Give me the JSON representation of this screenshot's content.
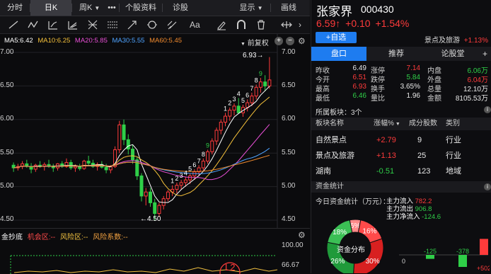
{
  "tabs": {
    "fenshi": "分时",
    "rik": "日K",
    "zhouk": "周K",
    "more": "•••",
    "ggzl": "个股资料",
    "zhengu": "诊股",
    "display": "显示",
    "drawline": "画线"
  },
  "ma": {
    "ma5": "MA5:6.42",
    "ma10": "MA10:6.25",
    "ma20": "MA20:5.85",
    "ma30": "MA30:5.55",
    "ma60": "MA60:5.45",
    "adjust": "前复权"
  },
  "colors": {
    "ma5": "#ffffff",
    "ma10": "#f5c13b",
    "ma20": "#e84fd6",
    "ma30": "#4fa3ff",
    "ma60": "#2ecc71",
    "up": "#ff3b3b",
    "down": "#2fcf48",
    "accent": "#1e7cf0"
  },
  "yaxis_left": [
    "7.00",
    "6.50",
    "6.00",
    "5.50",
    "5.00",
    "4.50"
  ],
  "yaxis_right": [
    "7.00",
    "6.50",
    "6.00",
    "5.50",
    "5.00",
    "4.50"
  ],
  "annotations": {
    "high": "6.93→",
    "low": "←4.50"
  },
  "chart_data": {
    "type": "candlestick",
    "ylim": [
      4.5,
      7.0
    ],
    "candles": [
      [
        5.32,
        5.36,
        5.22,
        5.28
      ],
      [
        5.28,
        5.34,
        5.24,
        5.3
      ],
      [
        5.3,
        5.38,
        5.26,
        5.34
      ],
      [
        5.34,
        5.4,
        5.28,
        5.3
      ],
      [
        5.3,
        5.35,
        5.2,
        5.26
      ],
      [
        5.26,
        5.34,
        5.22,
        5.32
      ],
      [
        5.32,
        5.38,
        5.28,
        5.3
      ],
      [
        5.3,
        5.36,
        5.24,
        5.33
      ],
      [
        5.33,
        5.4,
        5.28,
        5.3
      ],
      [
        5.3,
        5.34,
        5.22,
        5.28
      ],
      [
        5.28,
        5.35,
        5.24,
        5.34
      ],
      [
        5.34,
        5.38,
        5.28,
        5.3
      ],
      [
        5.3,
        5.42,
        5.28,
        5.36
      ],
      [
        5.36,
        5.4,
        5.25,
        5.28
      ],
      [
        5.28,
        5.33,
        5.22,
        5.3
      ],
      [
        5.3,
        5.34,
        5.24,
        5.27
      ],
      [
        5.27,
        5.4,
        5.25,
        5.38
      ],
      [
        5.38,
        5.46,
        5.32,
        5.35
      ],
      [
        5.35,
        5.4,
        5.28,
        5.3
      ],
      [
        5.3,
        5.36,
        5.24,
        5.33
      ],
      [
        5.33,
        5.38,
        5.27,
        5.29
      ],
      [
        5.29,
        5.34,
        5.2,
        5.25
      ],
      [
        5.25,
        5.32,
        5.2,
        5.3
      ],
      [
        5.3,
        5.6,
        5.28,
        5.55
      ],
      [
        5.55,
        5.98,
        5.5,
        5.92
      ],
      [
        5.92,
        6.0,
        5.62,
        5.7
      ],
      [
        5.7,
        5.78,
        5.48,
        5.56
      ],
      [
        5.56,
        5.62,
        5.34,
        5.4
      ],
      [
        5.4,
        5.44,
        5.1,
        5.16
      ],
      [
        5.16,
        5.2,
        4.78,
        4.86
      ],
      [
        4.86,
        4.98,
        4.72,
        4.92
      ],
      [
        4.92,
        4.98,
        4.7,
        4.76
      ],
      [
        4.76,
        4.82,
        4.5,
        4.6
      ],
      [
        4.6,
        4.76,
        4.55,
        4.72
      ],
      [
        4.72,
        4.86,
        4.66,
        4.82
      ],
      [
        4.82,
        4.95,
        4.78,
        4.92
      ],
      [
        4.92,
        5.02,
        4.86,
        4.96
      ],
      [
        4.96,
        5.06,
        4.9,
        5.02
      ],
      [
        5.02,
        5.1,
        4.96,
        5.06
      ],
      [
        5.06,
        5.14,
        5.0,
        5.1
      ],
      [
        5.1,
        5.2,
        5.04,
        5.16
      ],
      [
        5.16,
        5.26,
        5.1,
        5.22
      ],
      [
        5.22,
        5.32,
        5.16,
        5.28
      ],
      [
        5.28,
        5.42,
        5.24,
        5.38
      ],
      [
        5.38,
        5.55,
        5.34,
        5.52
      ],
      [
        5.52,
        5.72,
        5.48,
        5.68
      ],
      [
        5.68,
        5.88,
        5.62,
        5.84
      ],
      [
        5.84,
        6.0,
        5.78,
        5.96
      ],
      [
        5.96,
        6.1,
        5.9,
        6.05
      ],
      [
        6.05,
        6.18,
        5.98,
        6.14
      ],
      [
        6.14,
        6.24,
        6.06,
        6.2
      ],
      [
        6.2,
        6.32,
        6.14,
        6.1
      ],
      [
        6.1,
        6.22,
        6.04,
        6.18
      ],
      [
        6.18,
        6.3,
        6.12,
        6.25
      ],
      [
        6.25,
        6.4,
        6.2,
        6.35
      ],
      [
        6.35,
        6.52,
        6.3,
        6.48
      ],
      [
        6.48,
        6.62,
        6.4,
        6.56
      ],
      [
        6.56,
        6.66,
        6.42,
        6.5
      ],
      [
        6.5,
        6.93,
        6.46,
        6.59
      ]
    ],
    "count_marks": [
      {
        "i": 36,
        "t": "1"
      },
      {
        "i": 37,
        "t": "2"
      },
      {
        "i": 38,
        "t": "3"
      },
      {
        "i": 39,
        "t": "4"
      },
      {
        "i": 40,
        "t": "5"
      },
      {
        "i": 41,
        "t": "6"
      },
      {
        "i": 42,
        "t": "7"
      },
      {
        "i": 43,
        "t": "8"
      },
      {
        "i": 44,
        "t": "9"
      },
      {
        "i": 48,
        "t": "1"
      },
      {
        "i": 49,
        "t": "2"
      },
      {
        "i": 50,
        "t": "3"
      },
      {
        "i": 51,
        "t": "4"
      },
      {
        "i": 52,
        "t": "5"
      },
      {
        "i": 53,
        "t": "6"
      },
      {
        "i": 54,
        "t": "7"
      },
      {
        "i": 55,
        "t": "8"
      },
      {
        "i": 56,
        "t": "9"
      }
    ]
  },
  "indicator": {
    "title": "金抄底",
    "opp": "机会区:--",
    "risk": "风险区:--",
    "coef": "风险系数:--",
    "max": "100.00",
    "mid": "66.67"
  },
  "quote": {
    "name": "张家界",
    "code": "000430",
    "price": "6.59↑",
    "change": "+0.10",
    "pct": "+1.54%",
    "add": "+自选",
    "sector": "景点及旅游",
    "sector_pct": "+1.13%",
    "subtabs": [
      "盘口",
      "推荐",
      "论股堂"
    ],
    "stats": [
      [
        "昨收",
        "6.49",
        "涨停",
        "7.14",
        "内盘",
        "6.06万"
      ],
      [
        "今开",
        "6.51",
        "跌停",
        "5.84",
        "外盘",
        "6.04万"
      ],
      [
        "最高",
        "6.93",
        "换手",
        "3.65%",
        "总量",
        "12.10万"
      ],
      [
        "最低",
        "6.46",
        "量比",
        "1.96",
        "金额",
        "8105.53万"
      ]
    ],
    "blocks_title": "所属板块：3个",
    "block_headers": [
      "板块名称",
      "涨幅%",
      "成分股数",
      "类别"
    ],
    "blocks": [
      {
        "name": "自然景点",
        "pct": "+2.79",
        "count": "9",
        "type": "行业",
        "color": "#ff3b3b"
      },
      {
        "name": "景点及旅游",
        "pct": "+1.13",
        "count": "25",
        "type": "行业",
        "color": "#ff3b3b"
      },
      {
        "name": "湖南",
        "pct": "-0.51",
        "count": "123",
        "type": "地域",
        "color": "#2fcf48"
      }
    ],
    "funds_title": "资金统计",
    "funds_sub": "今日资金统计（万元）：",
    "funds": [
      {
        "label": "主力流入",
        "value": "782.2",
        "color": "#ff3b3b"
      },
      {
        "label": "主力流出",
        "value": "906.8",
        "color": "#2fcf48"
      },
      {
        "label": "主力净流入",
        "value": "-124.6",
        "color": "#2fcf48"
      }
    ],
    "pie_center": "资金分布",
    "pie": [
      {
        "pct": "6%",
        "color": "#ff8a8a"
      },
      {
        "pct": "16%",
        "color": "#ff4a4a"
      },
      {
        "pct": "30%",
        "color": "#d82020"
      },
      {
        "pct": "26%",
        "color": "#1f9a3a"
      },
      {
        "pct": "18%",
        "color": "#3bbf55"
      }
    ],
    "bars": [
      {
        "label": "-125",
        "color": "#2fcf48",
        "v": -125
      },
      {
        "label": "-378",
        "color": "#2fcf48",
        "v": -378
      },
      {
        "label": "+502",
        "color": "#ff3b3b",
        "v": 502
      }
    ],
    "bar_zero": "0"
  }
}
